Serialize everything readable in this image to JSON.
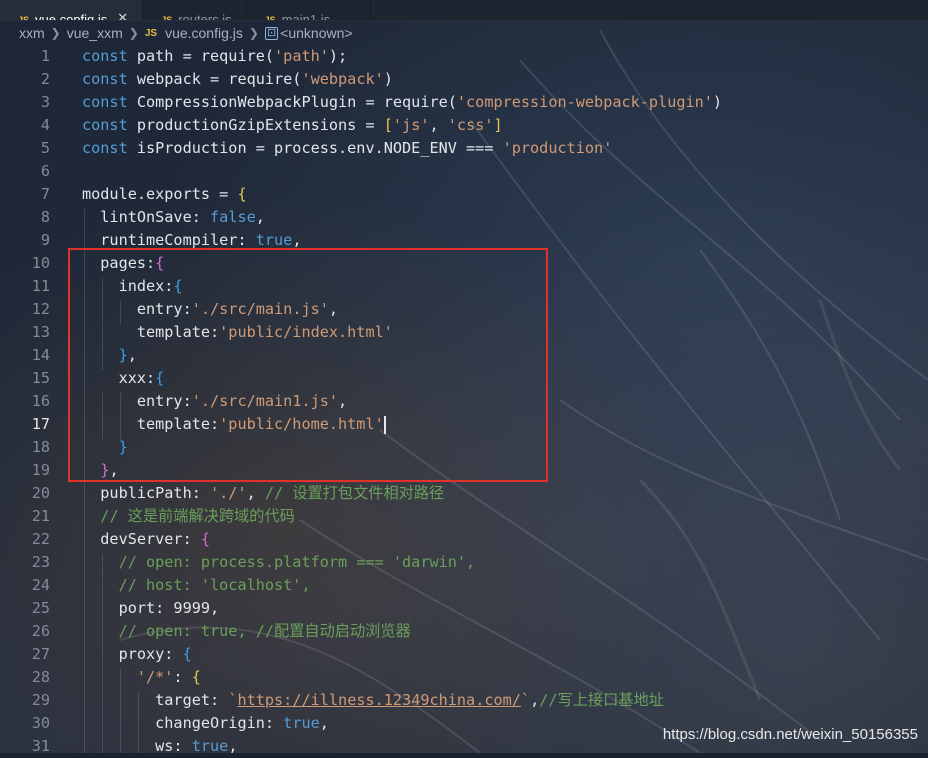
{
  "tabs": [
    {
      "label": "vue.config.js",
      "active": true,
      "icon": "js-file-icon"
    },
    {
      "label": "routers.js",
      "active": false,
      "icon": "js-file-icon"
    },
    {
      "label": "main1.js",
      "active": false,
      "icon": "js-file-icon"
    }
  ],
  "breadcrumb": {
    "root": "xxm",
    "folder": "vue_xxm",
    "file": "vue.config.js",
    "symbol": "<unknown>"
  },
  "editor": {
    "current_line": 17,
    "lines": [
      {
        "num": "1",
        "parts": [
          [
            "kw",
            "const"
          ],
          [
            "p",
            " path = require("
          ],
          [
            "str",
            "'path'"
          ],
          [
            "p",
            ");"
          ]
        ]
      },
      {
        "num": "2",
        "parts": [
          [
            "kw",
            "const"
          ],
          [
            "p",
            " webpack = require("
          ],
          [
            "str",
            "'webpack'"
          ],
          [
            "p",
            ")"
          ]
        ]
      },
      {
        "num": "3",
        "parts": [
          [
            "kw",
            "const"
          ],
          [
            "p",
            " CompressionWebpackPlugin = require("
          ],
          [
            "str",
            "'compression-webpack-plugin'"
          ],
          [
            "p",
            ")"
          ]
        ]
      },
      {
        "num": "4",
        "parts": [
          [
            "kw",
            "const"
          ],
          [
            "p",
            " productionGzipExtensions = "
          ],
          [
            "br1",
            "["
          ],
          [
            "str",
            "'js'"
          ],
          [
            "p",
            ", "
          ],
          [
            "str",
            "'css'"
          ],
          [
            "br1",
            "]"
          ]
        ]
      },
      {
        "num": "5",
        "parts": [
          [
            "kw",
            "const"
          ],
          [
            "p",
            " isProduction = process.env.NODE_ENV === "
          ],
          [
            "str",
            "'production'"
          ]
        ]
      },
      {
        "num": "6",
        "parts": []
      },
      {
        "num": "7",
        "parts": [
          [
            "p",
            "module.exports = "
          ],
          [
            "br1",
            "{"
          ]
        ]
      },
      {
        "num": "8",
        "parts": [
          [
            "p",
            "  lintOnSave: "
          ],
          [
            "bool",
            "false"
          ],
          [
            "p",
            ","
          ]
        ]
      },
      {
        "num": "9",
        "parts": [
          [
            "p",
            "  runtimeCompiler: "
          ],
          [
            "bool",
            "true"
          ],
          [
            "p",
            ","
          ]
        ]
      },
      {
        "num": "10",
        "parts": [
          [
            "p",
            "  pages:"
          ],
          [
            "br2",
            "{"
          ]
        ]
      },
      {
        "num": "11",
        "parts": [
          [
            "p",
            "    index:"
          ],
          [
            "br3",
            "{"
          ]
        ]
      },
      {
        "num": "12",
        "parts": [
          [
            "p",
            "      entry:"
          ],
          [
            "str",
            "'./src/main.js'"
          ],
          [
            "p",
            ","
          ]
        ]
      },
      {
        "num": "13",
        "parts": [
          [
            "p",
            "      template:"
          ],
          [
            "str",
            "'public/index.html'"
          ]
        ]
      },
      {
        "num": "14",
        "parts": [
          [
            "p",
            "    "
          ],
          [
            "br3",
            "}"
          ],
          [
            "p",
            ","
          ]
        ]
      },
      {
        "num": "15",
        "parts": [
          [
            "p",
            "    xxx:"
          ],
          [
            "br3",
            "{"
          ]
        ]
      },
      {
        "num": "16",
        "parts": [
          [
            "p",
            "      entry:"
          ],
          [
            "str",
            "'./src/main1.js'"
          ],
          [
            "p",
            ","
          ]
        ]
      },
      {
        "num": "17",
        "parts": [
          [
            "p",
            "      template:"
          ],
          [
            "str",
            "'public/home.html'"
          ],
          [
            "cursor",
            ""
          ]
        ]
      },
      {
        "num": "18",
        "parts": [
          [
            "p",
            "    "
          ],
          [
            "br3",
            "}"
          ]
        ]
      },
      {
        "num": "19",
        "parts": [
          [
            "p",
            "  "
          ],
          [
            "br2",
            "}"
          ],
          [
            "p",
            ","
          ]
        ]
      },
      {
        "num": "20",
        "parts": [
          [
            "p",
            "  publicPath: "
          ],
          [
            "str",
            "'./'"
          ],
          [
            "p",
            ", "
          ],
          [
            "cmt",
            "// 设置打包文件相对路径"
          ]
        ]
      },
      {
        "num": "21",
        "parts": [
          [
            "p",
            "  "
          ],
          [
            "cmt",
            "// 这是前端解决跨域的代码"
          ]
        ]
      },
      {
        "num": "22",
        "parts": [
          [
            "p",
            "  devServer: "
          ],
          [
            "br2",
            "{"
          ]
        ]
      },
      {
        "num": "23",
        "parts": [
          [
            "p",
            "    "
          ],
          [
            "cmt",
            "// open: process.platform === 'darwin',"
          ]
        ]
      },
      {
        "num": "24",
        "parts": [
          [
            "p",
            "    "
          ],
          [
            "cmt",
            "// host: 'localhost',"
          ]
        ]
      },
      {
        "num": "25",
        "parts": [
          [
            "p",
            "    port: 9999,"
          ]
        ]
      },
      {
        "num": "26",
        "parts": [
          [
            "p",
            "    "
          ],
          [
            "cmt",
            "// open: true, //配置自动启动浏览器"
          ]
        ]
      },
      {
        "num": "27",
        "parts": [
          [
            "p",
            "    proxy: "
          ],
          [
            "br3",
            "{"
          ]
        ]
      },
      {
        "num": "28",
        "parts": [
          [
            "p",
            "      "
          ],
          [
            "str",
            "'/*'"
          ],
          [
            "p",
            ": "
          ],
          [
            "br1",
            "{"
          ]
        ]
      },
      {
        "num": "29",
        "parts": [
          [
            "p",
            "        target: "
          ],
          [
            "str",
            "`"
          ],
          [
            "url",
            "https://illness.12349china.com/"
          ],
          [
            "str",
            "`"
          ],
          [
            "p",
            ","
          ],
          [
            "cmt",
            "//写上接口基地址"
          ]
        ]
      },
      {
        "num": "30",
        "parts": [
          [
            "p",
            "        changeOrigin: "
          ],
          [
            "bool",
            "true"
          ],
          [
            "p",
            ","
          ]
        ]
      },
      {
        "num": "31",
        "parts": [
          [
            "p",
            "        ws: "
          ],
          [
            "bool",
            "true"
          ],
          [
            "p",
            ","
          ]
        ]
      }
    ]
  },
  "watermark": "https://blog.csdn.net/weixin_50156355",
  "colors": {
    "keyword": "#569cd6",
    "string": "#d09a75",
    "comment": "#6aa05a",
    "highlight_box": "#e2302a"
  }
}
